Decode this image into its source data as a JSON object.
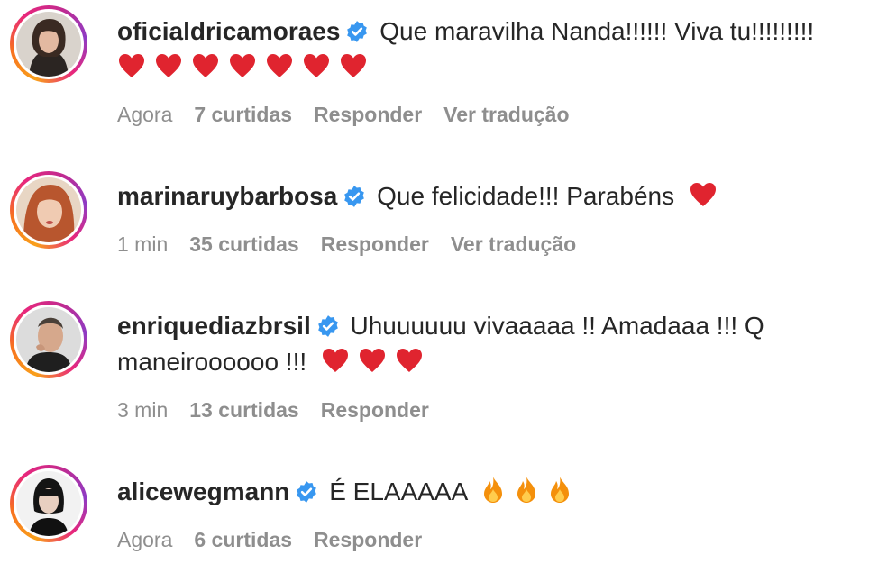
{
  "comments": [
    {
      "username": "oficialdricamoraes",
      "verified": true,
      "text": "Que maravilha Nanda!!!!!! Viva tu!!!!!!!!!",
      "emojis": [
        "heart",
        "heart",
        "heart",
        "heart",
        "heart",
        "heart",
        "heart"
      ],
      "time": "Agora",
      "likes": "7 curtidas",
      "reply_label": "Responder",
      "translate_label": "Ver tradução"
    },
    {
      "username": "marinaruybarbosa",
      "verified": true,
      "text": "Que felicidade!!! Parabéns",
      "emojis": [
        "heart"
      ],
      "time": "1 min",
      "likes": "35 curtidas",
      "reply_label": "Responder",
      "translate_label": "Ver tradução"
    },
    {
      "username": "enriquediazbrsil",
      "verified": true,
      "text": "Uhuuuuuu vivaaaaa !! Amadaaa !!! Q",
      "text_line2": "maneiroooooo !!!",
      "emojis": [
        "heart",
        "heart",
        "heart"
      ],
      "time": "3 min",
      "likes": "13 curtidas",
      "reply_label": "Responder"
    },
    {
      "username": "alicewegmann",
      "verified": true,
      "text": "É ELAAAAA",
      "emojis": [
        "fire",
        "fire",
        "fire"
      ],
      "time": "Agora",
      "likes": "6 curtidas",
      "reply_label": "Responder"
    }
  ],
  "colors": {
    "verified_badge": "#3897f0",
    "heart": "#e0242f",
    "fire": "#f4900c",
    "meta_text": "#8e8e8e",
    "text": "#262626"
  },
  "icons": {
    "verified": "verified-badge-icon",
    "heart": "red-heart-emoji",
    "fire": "fire-emoji"
  }
}
